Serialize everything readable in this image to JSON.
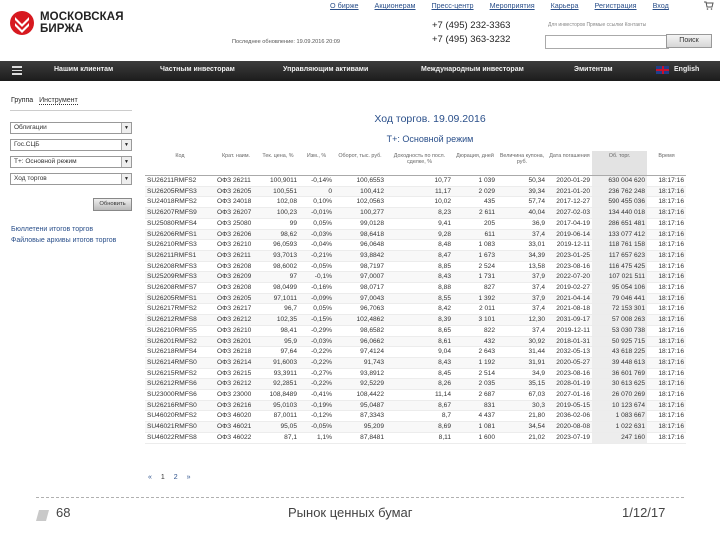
{
  "brand": {
    "line1": "МОСКОВСКАЯ",
    "line2": "БИРЖА",
    "color": "#d71920"
  },
  "top_nav": [
    "О бирже",
    "Акционерам",
    "Пресс-центр",
    "Мероприятия",
    "Карьера",
    "Регистрация",
    "Вход"
  ],
  "updated_text": "Последнее обновление: 19.09.2016 20:09",
  "phones": [
    "+7 (495) 232-3363",
    "+7 (495) 363-3232"
  ],
  "language_links": "Для инвесторов   Прямые ссылки   Контакты",
  "search": {
    "placeholder": "",
    "button": "Поиск"
  },
  "main_nav": [
    "Нашим клиентам",
    "Частным инвесторам",
    "Управляющим активами",
    "Международным инвесторам",
    "Эмитентам",
    "English"
  ],
  "left_panel": {
    "group_label": "Группа",
    "tool_label": "Инструмент",
    "selects": [
      "Облигации",
      "Гос.СЦБ",
      "Т+: Основной режим",
      "Ход торгов"
    ],
    "refresh_button": "Обновить",
    "links": [
      "Бюллетени итогов торгов",
      "Файловые архивы итогов торгов"
    ]
  },
  "main": {
    "title": "Ход торгов. 19.09.2016",
    "subtitle": "Т+: Основной режим",
    "columns": [
      "Код",
      "Крат. наим.",
      "Тек. цена, %",
      "Изм., %",
      "Оборот, тыс. руб.",
      "Доходность по посл. сделке, %",
      "Дюрация, дней",
      "Величина купона, руб.",
      "Дата погашения",
      "Об. торг.",
      "Время"
    ],
    "rows": [
      [
        "SU26211RMFS2",
        "ОФЗ 26211",
        "100,9011",
        "-0,14%",
        "100,6553",
        "10,77",
        "1 039",
        "50,34",
        "2020-01-29",
        "630 004 620",
        "18:17:16"
      ],
      [
        "SU26205RMFS3",
        "ОФЗ 26205",
        "100,551",
        "0",
        "100,412",
        "11,17",
        "2 029",
        "39,34",
        "2021-01-20",
        "236 762 248",
        "18:17:16"
      ],
      [
        "SU24018RMFS2",
        "ОФЗ 24018",
        "102,08",
        "0,10%",
        "102,0563",
        "10,02",
        "435",
        "57,74",
        "2017-12-27",
        "590 455 036",
        "18:17:16"
      ],
      [
        "SU26207RMFS9",
        "ОФЗ 26207",
        "100,23",
        "-0,01%",
        "100,277",
        "8,23",
        "2 611",
        "40,04",
        "2027-02-03",
        "134 440 018",
        "18:17:16"
      ],
      [
        "SU25080RMFS4",
        "ОФЗ 25080",
        "99",
        "0,05%",
        "99,0128",
        "9,41",
        "205",
        "36,9",
        "2017-04-19",
        "286 651 481",
        "18:17:16"
      ],
      [
        "SU26206RMFS1",
        "ОФЗ 26206",
        "98,62",
        "-0,03%",
        "98,6418",
        "9,28",
        "611",
        "37,4",
        "2019-06-14",
        "133 077 412",
        "18:17:16"
      ],
      [
        "SU26210RMFS3",
        "ОФЗ 26210",
        "96,0593",
        "-0,04%",
        "96,0648",
        "8,48",
        "1 083",
        "33,01",
        "2019-12-11",
        "118 761 158",
        "18:17:16"
      ],
      [
        "SU26211RMFS1",
        "ОФЗ 26211",
        "93,7013",
        "-0,21%",
        "93,8842",
        "8,47",
        "1 673",
        "34,39",
        "2023-01-25",
        "117 657 623",
        "18:17:16"
      ],
      [
        "SU26208RMFS3",
        "ОФЗ 26208",
        "98,6002",
        "-0,05%",
        "98,7197",
        "8,85",
        "2 524",
        "13,58",
        "2023-08-16",
        "116 475 425",
        "18:17:16"
      ],
      [
        "SU25209RMFS3",
        "ОФЗ 26209",
        "97",
        "-0,1%",
        "97,0007",
        "8,43",
        "1 731",
        "37,9",
        "2022-07-20",
        "107 021 511",
        "18:17:16"
      ],
      [
        "SU26208RMFS7",
        "ОФЗ 26208",
        "98,0499",
        "-0,16%",
        "98,0717",
        "8,88",
        "827",
        "37,4",
        "2019-02-27",
        "95 054 106",
        "18:17:16"
      ],
      [
        "SU26205RMFS1",
        "ОФЗ 26205",
        "97,1011",
        "-0,09%",
        "97,0043",
        "8,55",
        "1 392",
        "37,9",
        "2021-04-14",
        "79 046 441",
        "18:17:16"
      ],
      [
        "SU26217RMFS2",
        "ОФЗ 26217",
        "96,7",
        "0,05%",
        "96,7063",
        "8,42",
        "2 011",
        "37,4",
        "2021-08-18",
        "72 153 301",
        "18:17:16"
      ],
      [
        "SU26212RMFS8",
        "ОФЗ 26212",
        "102,35",
        "-0,15%",
        "102,4862",
        "8,39",
        "3 101",
        "12,30",
        "2031-09-17",
        "57 008 263",
        "18:17:16"
      ],
      [
        "SU26210RMFS5",
        "ОФЗ 26210",
        "98,41",
        "-0,29%",
        "98,6582",
        "8,65",
        "822",
        "37,4",
        "2019-12-11",
        "53 030 738",
        "18:17:16"
      ],
      [
        "SU26201RMFS2",
        "ОФЗ 26201",
        "95,9",
        "-0,03%",
        "96,0662",
        "8,61",
        "432",
        "30,92",
        "2018-01-31",
        "50 925 715",
        "18:17:16"
      ],
      [
        "SU26218RMFS4",
        "ОФЗ 26218",
        "97,64",
        "-0,22%",
        "97,4124",
        "9,04",
        "2 643",
        "31,44",
        "2032-05-13",
        "43 618 225",
        "18:17:16"
      ],
      [
        "SU26214RMFS0",
        "ОФЗ 26214",
        "91,6003",
        "-0,22%",
        "91,743",
        "8,43",
        "1 192",
        "31,91",
        "2020-05-27",
        "39 448 613",
        "18:17:16"
      ],
      [
        "SU26215RMFS2",
        "ОФЗ 26215",
        "93,3911",
        "-0,27%",
        "93,8912",
        "8,45",
        "2 514",
        "34,9",
        "2023-08-16",
        "36 601 769",
        "18:17:16"
      ],
      [
        "SU26212RMFS6",
        "ОФЗ 26212",
        "92,2851",
        "-0,22%",
        "92,5229",
        "8,26",
        "2 035",
        "35,15",
        "2028-01-19",
        "30 613 625",
        "18:17:16"
      ],
      [
        "SU23000RMFS6",
        "ОФЗ 23000",
        "108,8489",
        "-0,41%",
        "108,4422",
        "11,14",
        "2 687",
        "67,03",
        "2027-01-16",
        "26 070 269",
        "18:17:16"
      ],
      [
        "SU26216RMFS0",
        "ОФЗ 26216",
        "95,0103",
        "-0,19%",
        "95,0487",
        "8,67",
        "831",
        "30,3",
        "2019-05-15",
        "10 123 674",
        "18:17:16"
      ],
      [
        "SU46020RMFS2",
        "ОФЗ 46020",
        "87,0011",
        "-0,12%",
        "87,3343",
        "8,7",
        "4 437",
        "21,80",
        "2036-02-06",
        "1 083 667",
        "18:17:16"
      ],
      [
        "SU46021RMFS0",
        "ОФЗ 46021",
        "95,05",
        "-0,05%",
        "95,209",
        "8,69",
        "1 081",
        "34,54",
        "2020-08-08",
        "1 022 631",
        "18:17:16"
      ],
      [
        "SU46022RMFS8",
        "ОФЗ 46022",
        "87,1",
        "1,1%",
        "87,8481",
        "8,11",
        "1 600",
        "21,02",
        "2023-07-19",
        "247 160",
        "18:17:16"
      ]
    ],
    "pager": [
      "«",
      "1",
      "2",
      "»"
    ]
  },
  "footer": {
    "slide_number": "68",
    "title": "Рынок ценных бумаг",
    "date": "1/12/17"
  }
}
